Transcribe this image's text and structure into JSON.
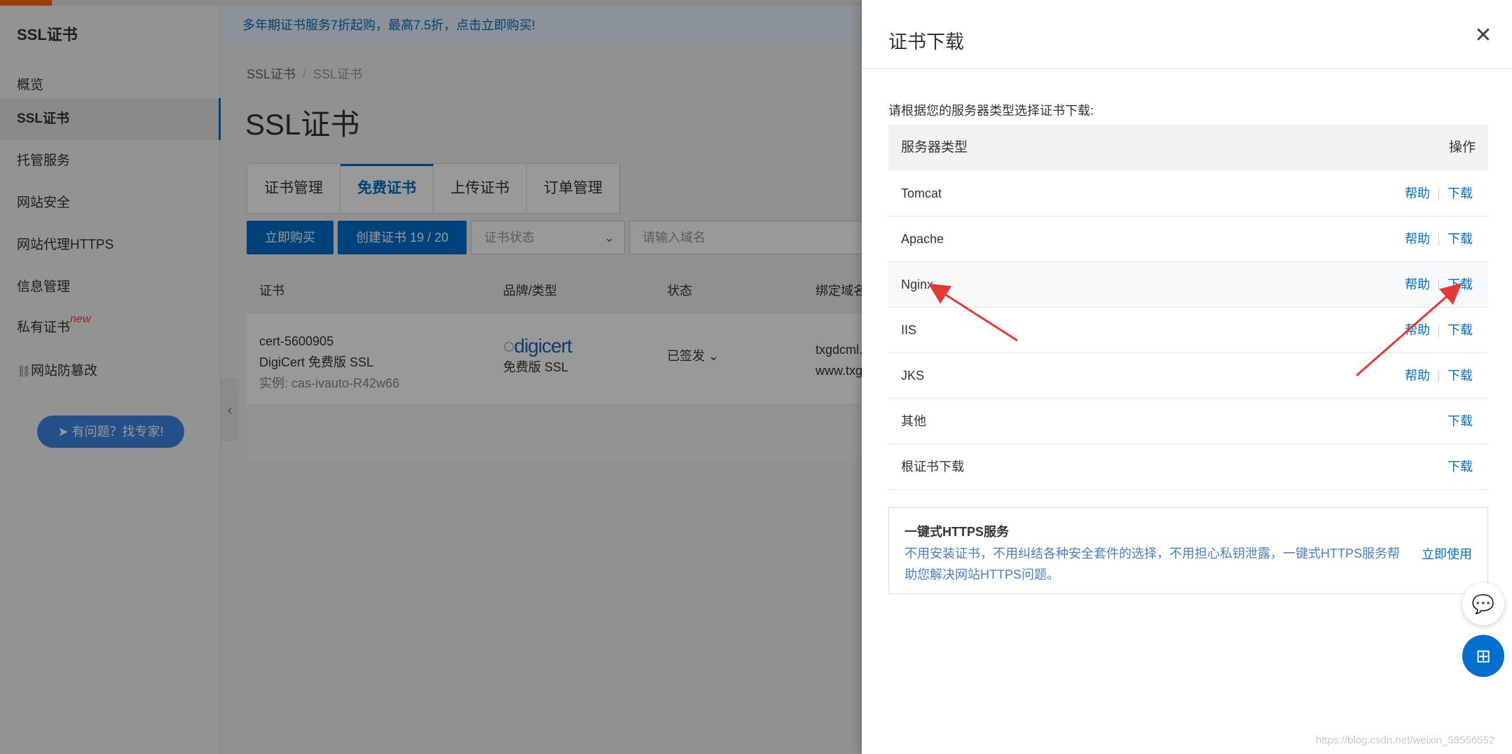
{
  "sidebar": {
    "title": "SSL证书",
    "items": [
      {
        "label": "概览"
      },
      {
        "label": "SSL证书"
      },
      {
        "label": "托管服务"
      },
      {
        "label": "网站安全"
      },
      {
        "label": "网站代理HTTPS"
      },
      {
        "label": "信息管理"
      },
      {
        "label": "私有证书",
        "badge": "new"
      },
      {
        "label": "网站防篡改"
      }
    ],
    "help_button": "有问题？找专家!"
  },
  "banner": "多年期证书服务7折起购，最高7.5折，点击立即购买!",
  "breadcrumb": [
    "SSL证书",
    "SSL证书"
  ],
  "page_title": "SSL证书",
  "tabs": [
    "证书管理",
    "免费证书",
    "上传证书",
    "订单管理"
  ],
  "toolbar": {
    "buy": "立即购买",
    "create": "创建证书 19 / 20",
    "status_select": "证书状态",
    "search_placeholder": "请输入域名"
  },
  "table": {
    "headers": [
      "证书",
      "品牌/类型",
      "状态",
      "绑定域名"
    ],
    "row": {
      "cert_id": "cert-5600905",
      "cert_name": "DigiCert 免费版 SSL",
      "instance": "实例: cas-ivauto-R42w66",
      "brand": "digicert",
      "brand_type": "免费版 SSL",
      "status": "已签发",
      "domain1": "txgdcml.",
      "domain2": "www.txg"
    }
  },
  "drawer": {
    "title": "证书下载",
    "intro": "请根据您的服务器类型选择证书下载:",
    "header_type": "服务器类型",
    "header_op": "操作",
    "help_label": "帮助",
    "download_label": "下载",
    "rows": [
      {
        "name": "Tomcat"
      },
      {
        "name": "Apache"
      },
      {
        "name": "Nginx"
      },
      {
        "name": "IIS"
      },
      {
        "name": "JKS"
      },
      {
        "name": "其他"
      },
      {
        "name": "根证书下载"
      }
    ],
    "https_title": "一键式HTTPS服务",
    "https_desc": "不用安装证书，不用纠结各种安全套件的选择，不用担心私钥泄露，一键式HTTPS服务帮助您解决网站HTTPS问题。",
    "https_use": "立即使用"
  },
  "watermark": "https://blog.csdn.net/weixin_58556552",
  "colors": {
    "accent": "#0070cc",
    "brand_orange": "#ff6a00",
    "arrow": "#e53935"
  }
}
